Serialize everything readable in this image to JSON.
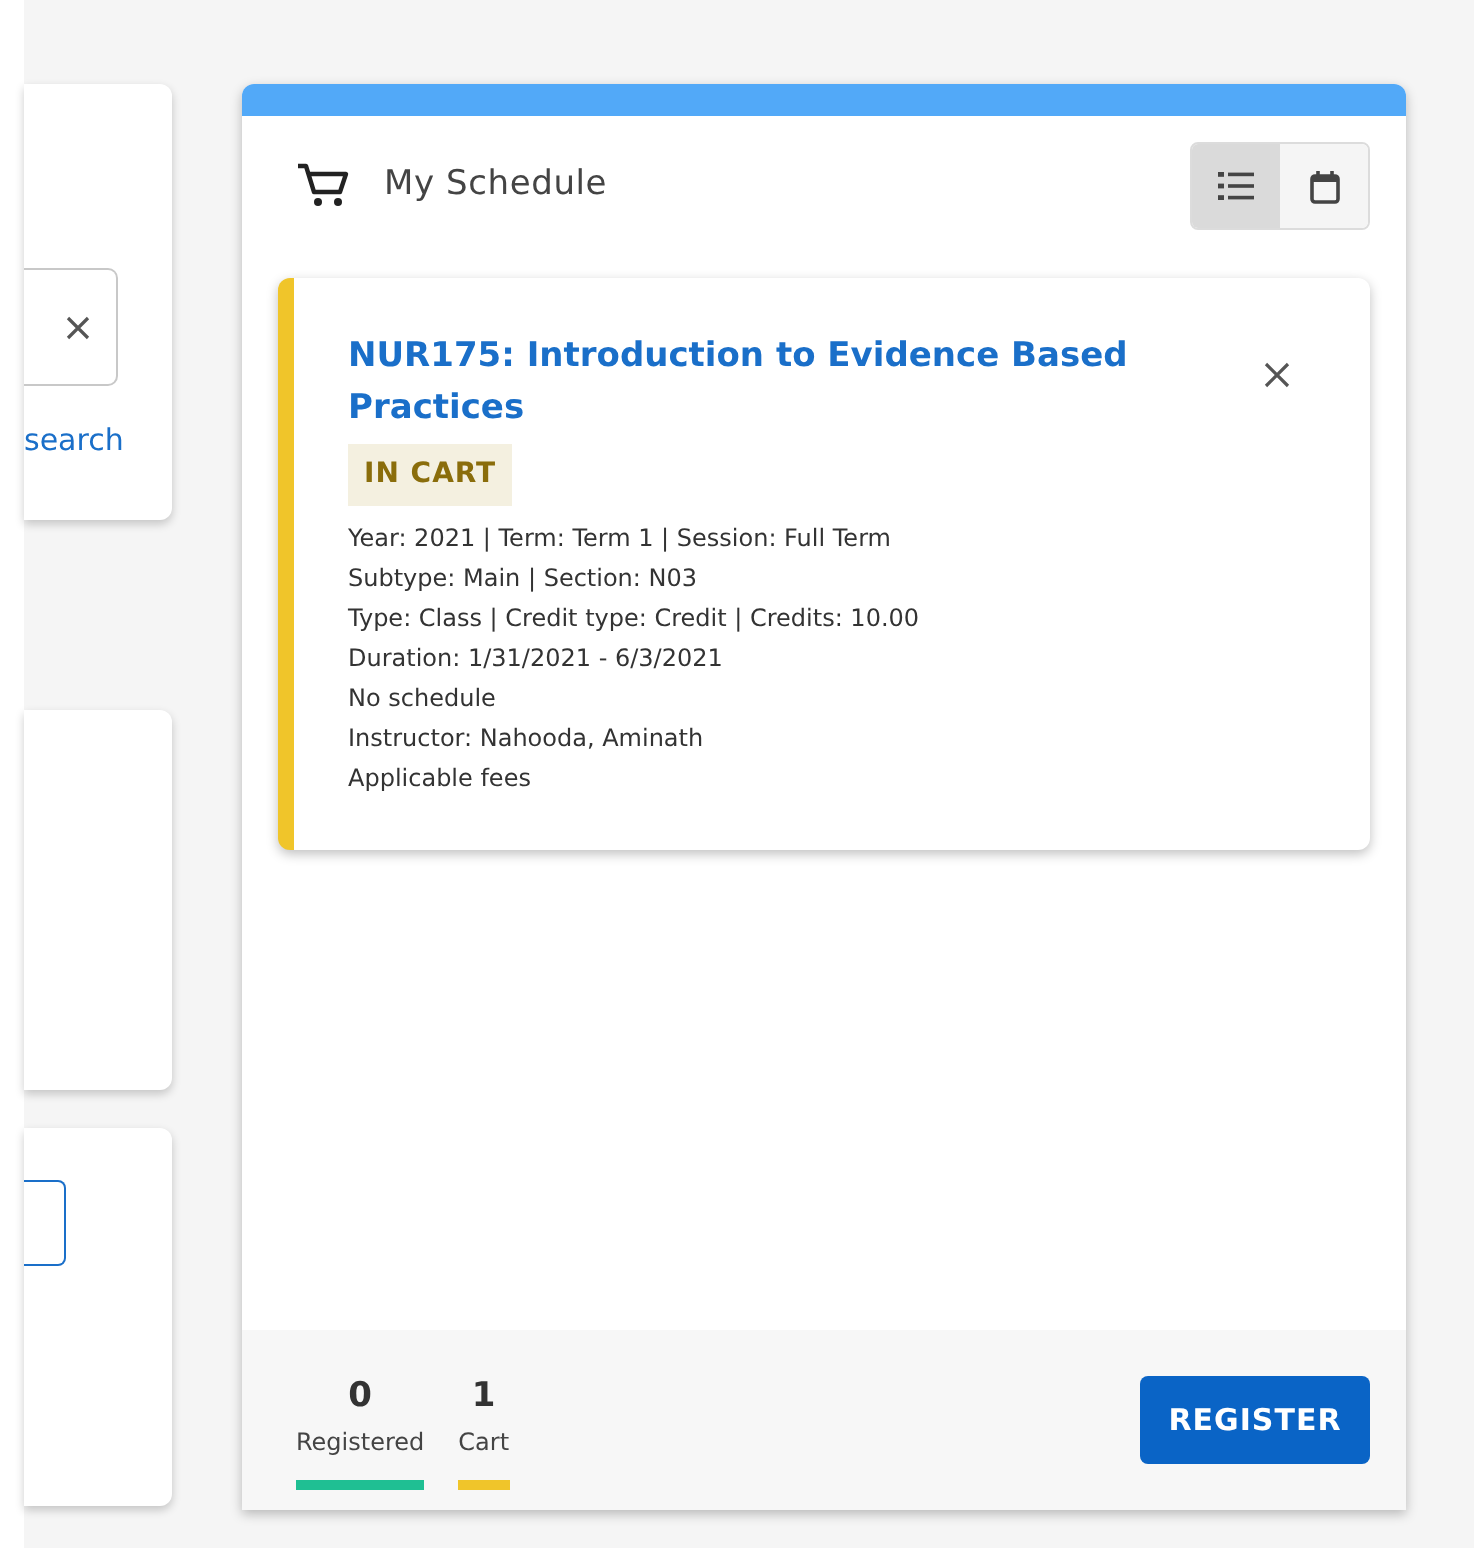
{
  "left_panel": {
    "search_link": "search"
  },
  "schedule": {
    "title": "My Schedule",
    "views": [
      {
        "kind": "list",
        "selected": true
      },
      {
        "kind": "calendar",
        "selected": false
      }
    ],
    "courses": [
      {
        "title": "NUR175: Introduction to Evidence Based Practices",
        "status": "IN CART",
        "color": "#f0c52a",
        "details": [
          "Year: 2021 | Term: Term 1 | Session: Full Term",
          "Subtype: Main | Section: N03",
          "Type: Class | Credit type: Credit | Credits: 10.00",
          "Duration: 1/31/2021 - 6/3/2021",
          "No schedule",
          "Instructor: Nahooda, Aminath",
          "Applicable fees"
        ]
      }
    ],
    "stats": [
      {
        "value": "0",
        "label": "Registered",
        "color": "#1fbf93"
      },
      {
        "value": "1",
        "label": "Cart",
        "color": "#f0c52a"
      }
    ],
    "register_button": "REGISTER"
  }
}
